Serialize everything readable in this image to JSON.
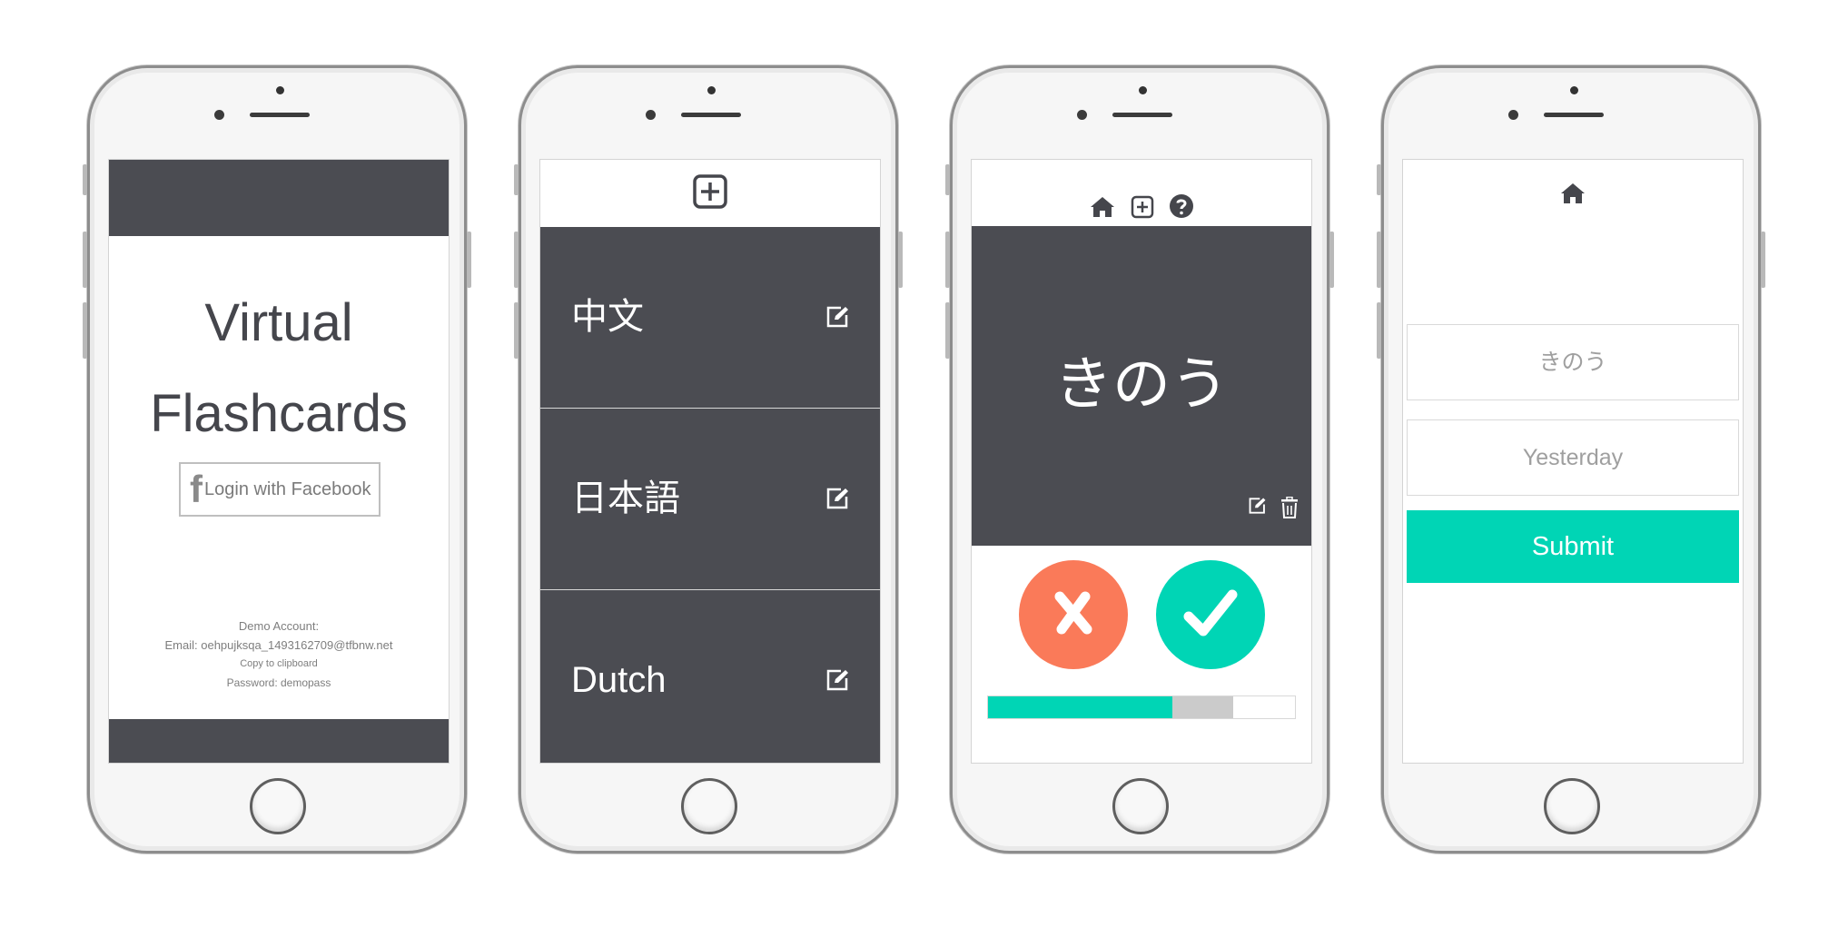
{
  "colors": {
    "dark": "#4b4c52",
    "accent": "#00d5b5",
    "wrong": "#fa7a59",
    "progress_remaining": "#cbcbcb"
  },
  "login": {
    "title_line1": "Virtual",
    "title_line2": "Flashcards",
    "facebook_icon": "facebook-icon",
    "facebook_f": "f",
    "facebook_button": "Login with Facebook",
    "demo_title": "Demo Account:",
    "demo_email": "Email: oehpujksqa_1493162709@tfbnw.net",
    "copy_link": "Copy to clipboard",
    "demo_password": "Password: demopass"
  },
  "decks": {
    "toolbar_icons": [
      "plus-square-icon"
    ],
    "items": [
      {
        "label": "中文",
        "icon": "edit-icon"
      },
      {
        "label": "日本語",
        "icon": "edit-icon"
      },
      {
        "label": "Dutch",
        "icon": "edit-icon"
      }
    ]
  },
  "study": {
    "toolbar_icons": [
      "home-icon",
      "plus-square-icon",
      "question-icon"
    ],
    "card_word": "きのう",
    "card_icons": [
      "edit-icon",
      "trash-icon"
    ],
    "wrong_icon": "cross-icon",
    "right_icon": "check-icon",
    "progress": {
      "correct_fraction": 0.6,
      "wrong_fraction": 0.2
    }
  },
  "add_card": {
    "toolbar_icons": [
      "home-icon"
    ],
    "front_placeholder": "きのう",
    "back_placeholder": "Yesterday",
    "submit_label": "Submit"
  }
}
